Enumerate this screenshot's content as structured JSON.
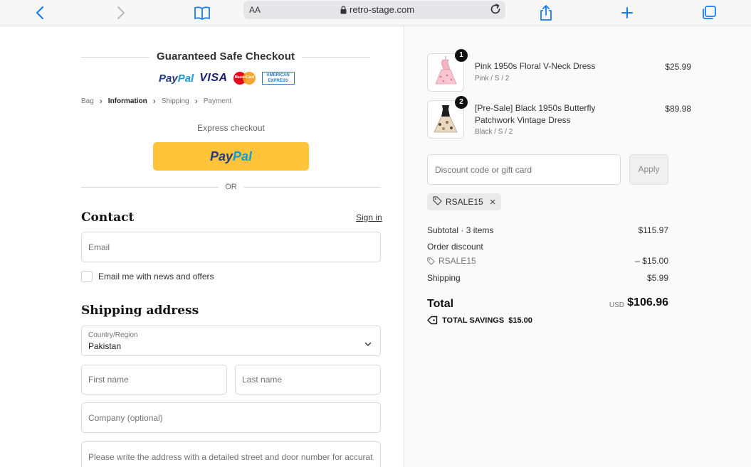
{
  "browser": {
    "text_size_label": "AA",
    "url": "retro-stage.com"
  },
  "header": {
    "safe_checkout_title": "Guaranteed Safe Checkout",
    "payment_logos": [
      "PayPal",
      "VISA",
      "MasterCard",
      "AMERICAN EXPRESS"
    ]
  },
  "breadcrumb": {
    "items": [
      "Bag",
      "Information",
      "Shipping",
      "Payment"
    ],
    "active": "Information"
  },
  "express": {
    "label": "Express checkout",
    "paypal_button": {
      "pay": "Pay",
      "pal": "Pal"
    },
    "or_label": "OR"
  },
  "contact": {
    "heading": "Contact",
    "sign_in": "Sign in",
    "email_placeholder": "Email",
    "newsletter_label": "Email me with news and offers"
  },
  "shipping": {
    "heading": "Shipping address",
    "country_label": "Country/Region",
    "country_value": "Pakistan",
    "first_name_placeholder": "First name",
    "last_name_placeholder": "Last name",
    "company_placeholder": "Company (optional)",
    "address_placeholder": "Please write the address with a detailed street and door number for accurat..."
  },
  "cart": {
    "items": [
      {
        "quantity": "1",
        "name": "Pink 1950s Floral V-Neck Dress",
        "variant": "Pink / S / 2",
        "price": "$25.99"
      },
      {
        "quantity": "2",
        "name": "[Pre-Sale] Black 1950s Butterfly Patchwork Vintage Dress",
        "variant": "Black / S / 2",
        "price": "$89.98"
      }
    ],
    "discount_placeholder": "Discount code or gift card",
    "apply_label": "Apply",
    "applied_code": "RSALE15"
  },
  "summary": {
    "subtotal_label": "Subtotal · 3 items",
    "subtotal_value": "$115.97",
    "order_discount_label": "Order discount",
    "discount_code": "RSALE15",
    "discount_value": "– $15.00",
    "shipping_label": "Shipping",
    "shipping_value": "$5.99",
    "total_label": "Total",
    "currency": "USD",
    "total_value": "$106.96",
    "savings_label": "TOTAL SAVINGS",
    "savings_value": "$15.00"
  },
  "colors": {
    "paypal_yellow": "#ffc439",
    "paypal_dark_blue": "#253b80",
    "paypal_light_blue": "#179bd7",
    "safari_blue": "#1a7cf5"
  }
}
